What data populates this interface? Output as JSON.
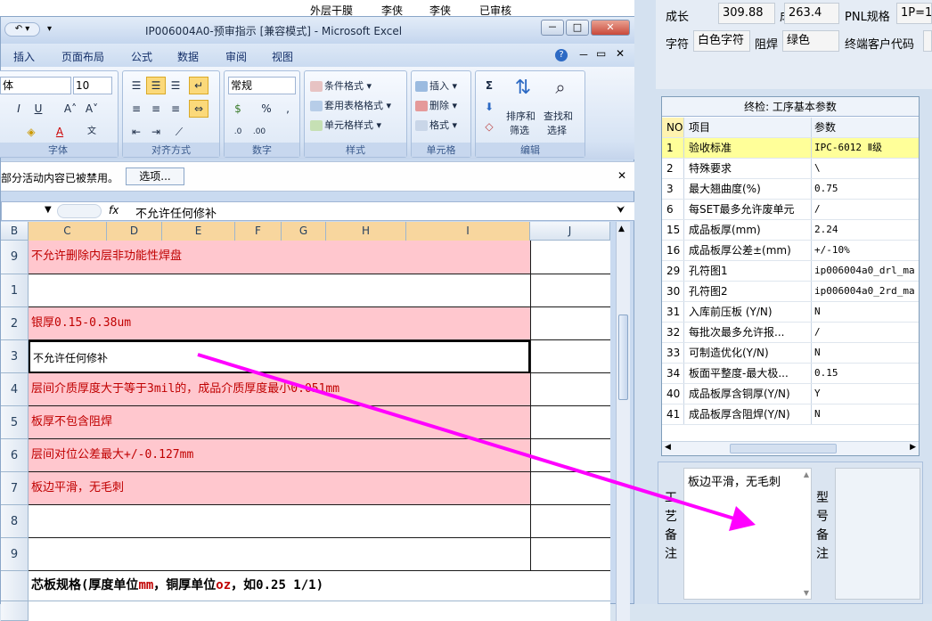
{
  "background_app": {
    "cells": [
      "外层干膜",
      "李侠",
      "李侠",
      "已审核"
    ]
  },
  "excel": {
    "title": "IP006004A0-预审指示  [兼容模式] - Microsoft Excel",
    "window_buttons": [
      "－",
      "□",
      "✕"
    ],
    "tabs": [
      "插入",
      "页面布局",
      "公式",
      "数据",
      "审阅",
      "视图"
    ],
    "ribbon": {
      "font_name": "体",
      "font_size": "10",
      "number_format": "常规",
      "groups": [
        "字体",
        "对齐方式",
        "数字",
        "样式",
        "单元格",
        "编辑"
      ],
      "style_items": [
        "条件格式",
        "套用表格格式",
        "单元格样式"
      ],
      "cell_items": [
        "插入",
        "删除",
        "格式"
      ],
      "edit_items": [
        "排序和\n筛选",
        "查找和\n选择"
      ],
      "sort_label_1": "排序和",
      "sort_label_2": "筛选",
      "find_label_1": "查找和",
      "find_label_2": "选择"
    },
    "message_bar": {
      "text": "部分活动内容已被禁用。",
      "button": "选项..."
    },
    "formula_bar": {
      "fx": "fx",
      "value": "不允许任何修补"
    },
    "columns": [
      "B",
      "C",
      "D",
      "E",
      "F",
      "G",
      "H",
      "I",
      "J"
    ],
    "rows": [
      {
        "num": "9",
        "text": "不允许删除内层非功能性焊盘",
        "pink": true
      },
      {
        "num": "1",
        "text": "",
        "pink": false
      },
      {
        "num": "2",
        "text": "银厚0.15-0.38um",
        "pink": true
      },
      {
        "num": "3",
        "text": "不允许任何修补",
        "pink": false
      },
      {
        "num": "4",
        "text": "层间介质厚度大于等于3mil的，成品介质厚度最小0.051mm",
        "pink": true
      },
      {
        "num": "5",
        "text": "板厚不包含阻焊",
        "pink": true
      },
      {
        "num": "6",
        "text": "层间对位公差最大+/-0.127mm",
        "pink": true
      },
      {
        "num": "7",
        "text": "板边平滑，无毛刺",
        "pink": true
      },
      {
        "num": "8",
        "text": "",
        "pink": false
      },
      {
        "num": "9",
        "text": "",
        "pink": false
      }
    ],
    "footer_row": {
      "prefix": "芯板规格(厚度单位",
      "unit1": "mm",
      "mid": "，铜厚单位",
      "unit2": "oz",
      "suffix": "，如0.25 1/1)"
    }
  },
  "right_panel": {
    "fields": {
      "length_label": "成长",
      "length_value": "309.88",
      "width_label": "成宽",
      "width_value": "263.4",
      "pnl_label": "PNL规格",
      "pnl_value": "1P=1",
      "char_label": "字符",
      "char_value": "白色字符",
      "mask_label": "阻焊",
      "mask_value": "绿色",
      "customer_label": "终端客户代码"
    },
    "table": {
      "title": "终检: 工序基本参数",
      "headers": [
        "NO",
        "项目",
        "参数"
      ],
      "rows": [
        {
          "no": "1",
          "item": "验收标准",
          "param": "IPC-6012 Ⅱ级"
        },
        {
          "no": "2",
          "item": "特殊要求",
          "param": "\\"
        },
        {
          "no": "3",
          "item": "最大翘曲度(%)",
          "param": "0.75"
        },
        {
          "no": "6",
          "item": "每SET最多允许废单元",
          "param": "/"
        },
        {
          "no": "15",
          "item": "成品板厚(mm)",
          "param": "2.24"
        },
        {
          "no": "16",
          "item": "成品板厚公差±(mm)",
          "param": "+/-10%"
        },
        {
          "no": "29",
          "item": "孔符图1",
          "param": "ip006004a0_drl_ma"
        },
        {
          "no": "30",
          "item": "孔符图2",
          "param": "ip006004a0_2rd_ma"
        },
        {
          "no": "31",
          "item": "入库前压板 (Y/N)",
          "param": "N"
        },
        {
          "no": "32",
          "item": "每批次最多允许报...",
          "param": "/"
        },
        {
          "no": "33",
          "item": "可制造优化(Y/N)",
          "param": "N"
        },
        {
          "no": "34",
          "item": "板面平整度-最大极...",
          "param": "0.15"
        },
        {
          "no": "40",
          "item": "成品板厚含铜厚(Y/N)",
          "param": "Y"
        },
        {
          "no": "41",
          "item": "成品板厚含阻焊(Y/N)",
          "param": "N"
        }
      ]
    },
    "process_note_label": [
      "工",
      "艺",
      "备",
      "注"
    ],
    "process_note_text": "板边平滑，无毛刺",
    "model_note_label": [
      "型",
      "号",
      "备",
      "注"
    ]
  },
  "colors": {
    "pink_cell": "#ffc7ce",
    "red_text": "#c00000",
    "arrow": "#ff00ff",
    "selected_row": "#ffff99"
  }
}
